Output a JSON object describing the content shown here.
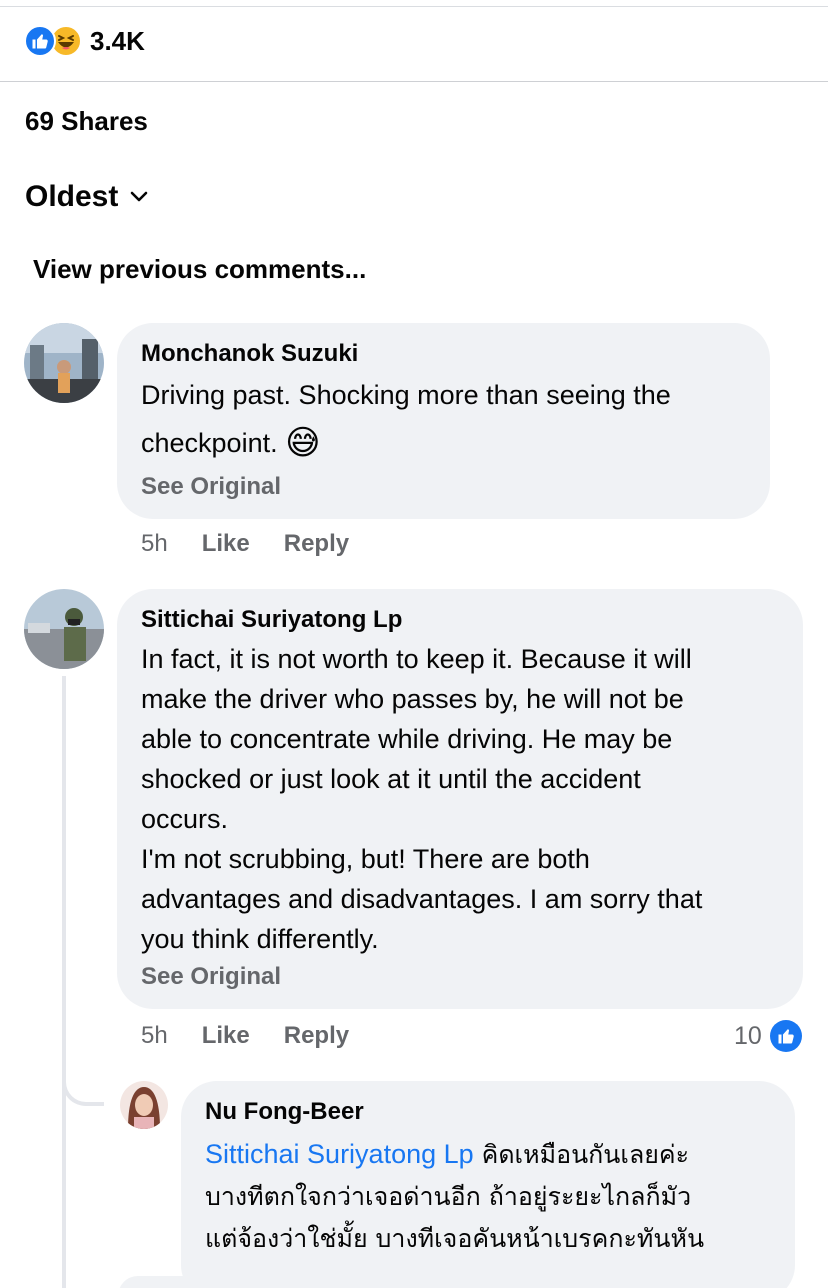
{
  "reactions": {
    "count": "3.4K",
    "icons": [
      "like-icon",
      "haha-icon"
    ]
  },
  "shares": "69 Shares",
  "sort": {
    "label": "Oldest",
    "icon": "chevron-down-icon"
  },
  "view_previous": "View previous comments...",
  "comments": [
    {
      "author": "Monchanok Suzuki",
      "lines": [
        "Driving past. Shocking more than seeing the",
        "checkpoint. "
      ],
      "emoji": "😅",
      "see_original": "See Original",
      "time": "5h",
      "like_label": "Like",
      "reply_label": "Reply"
    },
    {
      "author": "Sittichai Suriyatong Lp",
      "lines": [
        "In fact, it is not worth to keep it. Because it will",
        "make the driver who passes by, he will not be",
        "able to concentrate while driving. He may be",
        "shocked or just look at it until the accident",
        "occurs.",
        "I'm not scrubbing, but! There are both",
        "advantages and disadvantages. I am sorry that",
        "you think differently."
      ],
      "see_original": "See Original",
      "time": "5h",
      "like_label": "Like",
      "reply_label": "Reply",
      "likes": "10"
    }
  ],
  "reply": {
    "author": "Nu Fong-Beer",
    "mention": "Sittichai Suriyatong Lp",
    "lines": [
      " คิดเหมือนกันเลยค่ะ",
      "บางทีตกใจกว่าเจอด่านอีก ถ้าอยู่ระยะไกลก็มัว",
      "แต่จ้องว่าใช่มั้ย บางทีเจอคันหน้าเบรคกะทันหัน"
    ]
  },
  "colors": {
    "accent": "#1877f2",
    "bubble": "#f0f2f5",
    "secondary_text": "#65676b",
    "haha": "#f7b928"
  }
}
